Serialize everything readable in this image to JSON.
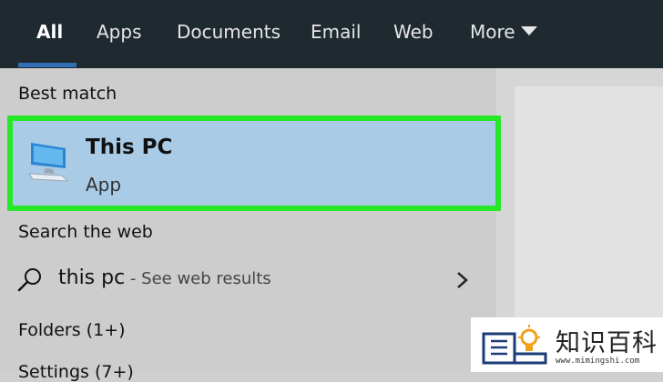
{
  "tabs": [
    {
      "label": "All",
      "active": true
    },
    {
      "label": "Apps"
    },
    {
      "label": "Documents"
    },
    {
      "label": "Email"
    },
    {
      "label": "Web"
    },
    {
      "label": "More"
    }
  ],
  "sections": {
    "best_match": "Best match",
    "search_web": "Search the web",
    "folders": "Folders (1+)",
    "settings": "Settings (7+)"
  },
  "best_match_item": {
    "title": "This PC",
    "subtitle": "App",
    "icon": "computer-icon"
  },
  "web_result": {
    "query": "this pc",
    "suffix": " - See web results"
  },
  "watermark": {
    "text": "知识百科",
    "url": "www.mimingshi.com"
  },
  "colors": {
    "tabbar": "#1f2a30",
    "accent_underline": "#2f6db5",
    "highlight_border": "#27e828",
    "selected_bg": "#a9cbe6"
  }
}
